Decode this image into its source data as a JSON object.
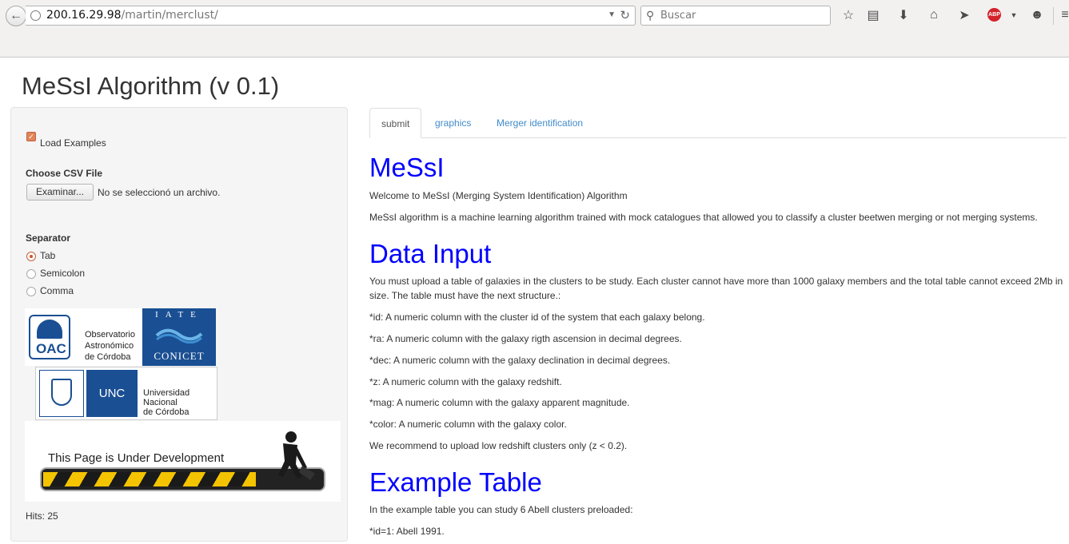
{
  "browser": {
    "url_host": "200.16.29.98",
    "url_path": "/martin/merclust/",
    "search_placeholder": "Buscar"
  },
  "page_title": "MeSsI Algorithm (v 0.1)",
  "sidebar": {
    "load_examples_label": "Load Examples",
    "load_examples_checked": true,
    "file_label": "Choose CSV File",
    "file_button": "Examinar...",
    "file_status": "No se seleccionó un archivo.",
    "separator_label": "Separator",
    "separators": [
      "Tab",
      "Semicolon",
      "Comma"
    ],
    "separator_selected": "Tab",
    "logos": {
      "oac_abbr": "OAC",
      "oac_name": [
        "Observatorio",
        "Astronómico",
        "de Córdoba"
      ],
      "conicet_top": "IATE",
      "conicet_bottom": "CONICET",
      "unc_abbr": "UNC",
      "unc_name": [
        "Universidad",
        "Nacional",
        "de Córdoba"
      ],
      "dev_banner": "This Page is Under Development"
    },
    "hits": "Hits: 25"
  },
  "tabs": [
    "submit",
    "graphics",
    "Merger identification"
  ],
  "tab_active": "submit",
  "content": {
    "h_messi": "MeSsI",
    "welcome": "Welcome to MeSsI (Merging System Identification) Algorithm",
    "intro": "MeSsI algorithm is a machine learning algorithm trained with mock catalogues that allowed you to classify a cluster beetwen merging or not merging systems.",
    "h_data_input": "Data Input",
    "upload": "You must upload a table of galaxies in the clusters to be study. Each cluster cannot have more than 1000 galaxy members and the total table cannot exceed 2Mb in size. The table must have the next structure.:",
    "columns": [
      "*id: A numeric column with the cluster id of the system that each galaxy belong.",
      "*ra: A numeric column with the galaxy rigth ascension in decimal degrees.",
      "*dec: A numeric column with the galaxy declination in decimal degrees.",
      "*z: A numeric column with the galaxy redshift.",
      "*mag: A numeric column with the galaxy apparent magnitude.",
      "*color: A numeric column with the galaxy color."
    ],
    "recommend": "We recommend to upload low redshift clusters only (z < 0.2).",
    "h_example": "Example Table",
    "example_intro": "In the example table you can study 6 Abell clusters preloaded:",
    "example_first": "*id=1: Abell 1991."
  },
  "colors": {
    "heading": "#0000ff",
    "link": "#428bca",
    "accent": "#d2552b"
  }
}
